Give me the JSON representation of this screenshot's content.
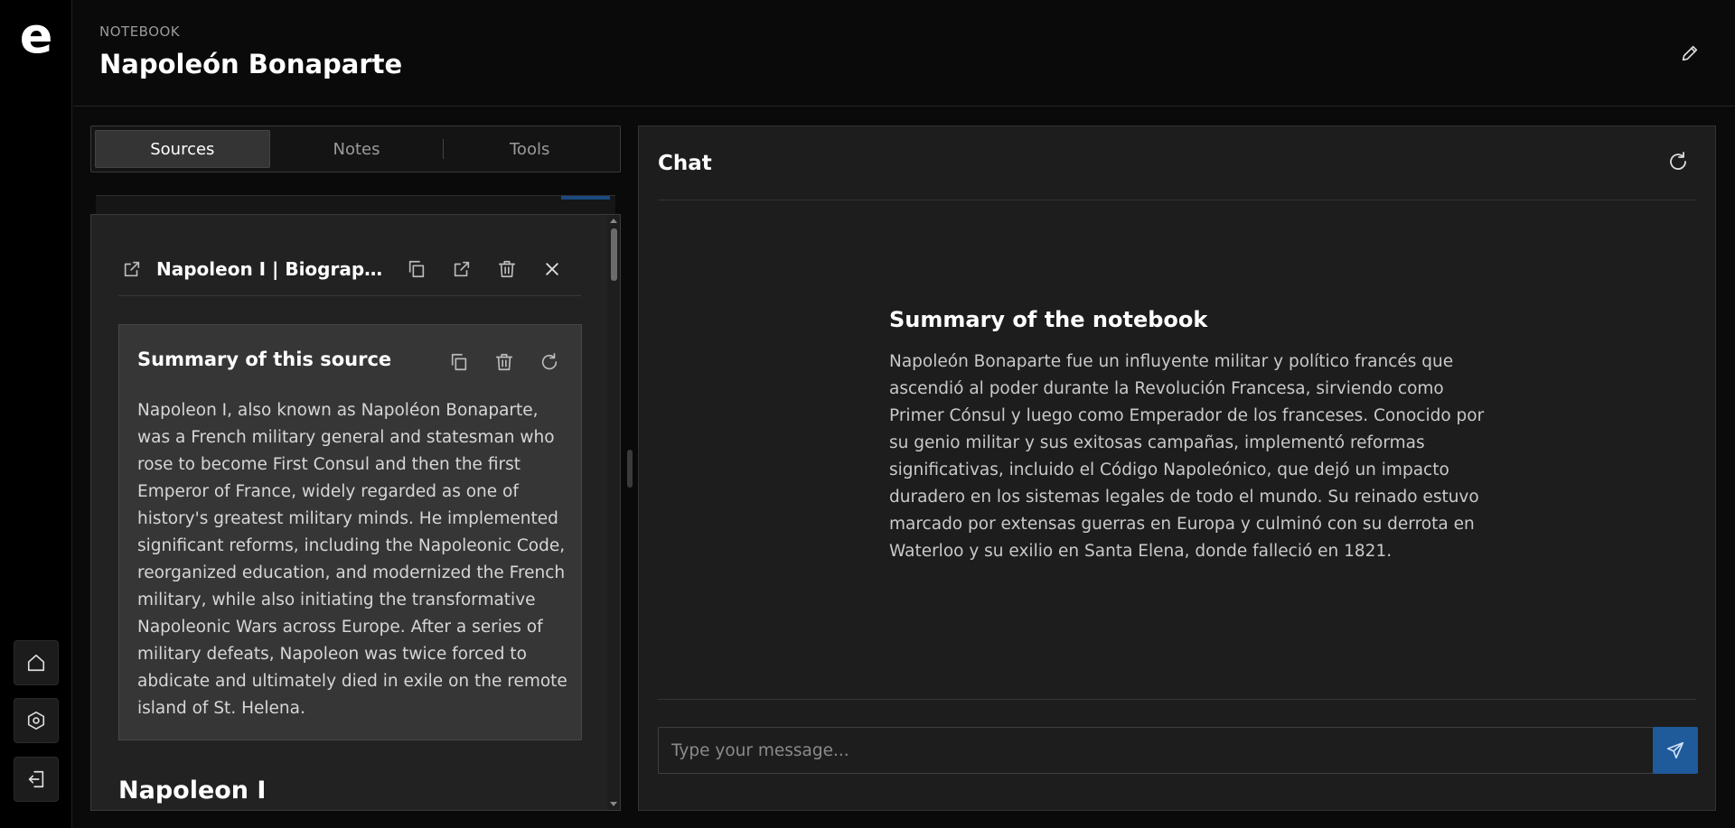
{
  "app": {
    "logo_letter": "e"
  },
  "rail": {
    "items": [
      {
        "name": "home",
        "icon": "home-icon"
      },
      {
        "name": "settings",
        "icon": "settings-icon"
      },
      {
        "name": "logout",
        "icon": "logout-icon"
      }
    ]
  },
  "header": {
    "kicker": "NOTEBOOK",
    "title": "Napoleón Bonaparte",
    "edit_icon": "pencil-icon"
  },
  "tabs": [
    {
      "label": "Sources",
      "active": true
    },
    {
      "label": "Notes",
      "active": false
    },
    {
      "label": "Tools",
      "active": false
    }
  ],
  "source": {
    "title": "Napoleon I | Biography, A...",
    "summary_title": "Summary of this source",
    "summary_text": "Napoleon I, also known as Napoléon Bonaparte, was a French military general and statesman who rose to become First Consul and then the first Emperor of France, widely regarded as one of history's greatest military minds. He implemented significant reforms, including the Napoleonic Code, reorganized education, and modernized the French military, while also initiating the transformative Napoleonic Wars across Europe. After a series of military defeats, Napoleon was twice forced to abdicate and ultimately died in exile on the remote island of St. Helena.",
    "heading": "Napoleon I"
  },
  "chat": {
    "title": "Chat",
    "summary_title": "Summary of the notebook",
    "summary_text": "Napoleón Bonaparte fue un influyente militar y político francés que ascendió al poder durante la Revolución Francesa, sirviendo como Primer Cónsul y luego como Emperador de los franceses. Conocido por su genio militar y sus exitosas campañas, implementó reformas significativas, incluido el Código Napoleónico, que dejó un impacto duradero en los sistemas legales de todo el mundo. Su reinado estuvo marcado por extensas guerras en Europa y culminó con su derrota en Waterloo y su exilio en Santa Elena, donde falleció en 1821.",
    "input_placeholder": "Type your message...",
    "input_value": ""
  },
  "colors": {
    "accent": "#1f5a9a",
    "background": "#0a0a0a",
    "panel": "#1d1d1d",
    "card": "#363636"
  }
}
